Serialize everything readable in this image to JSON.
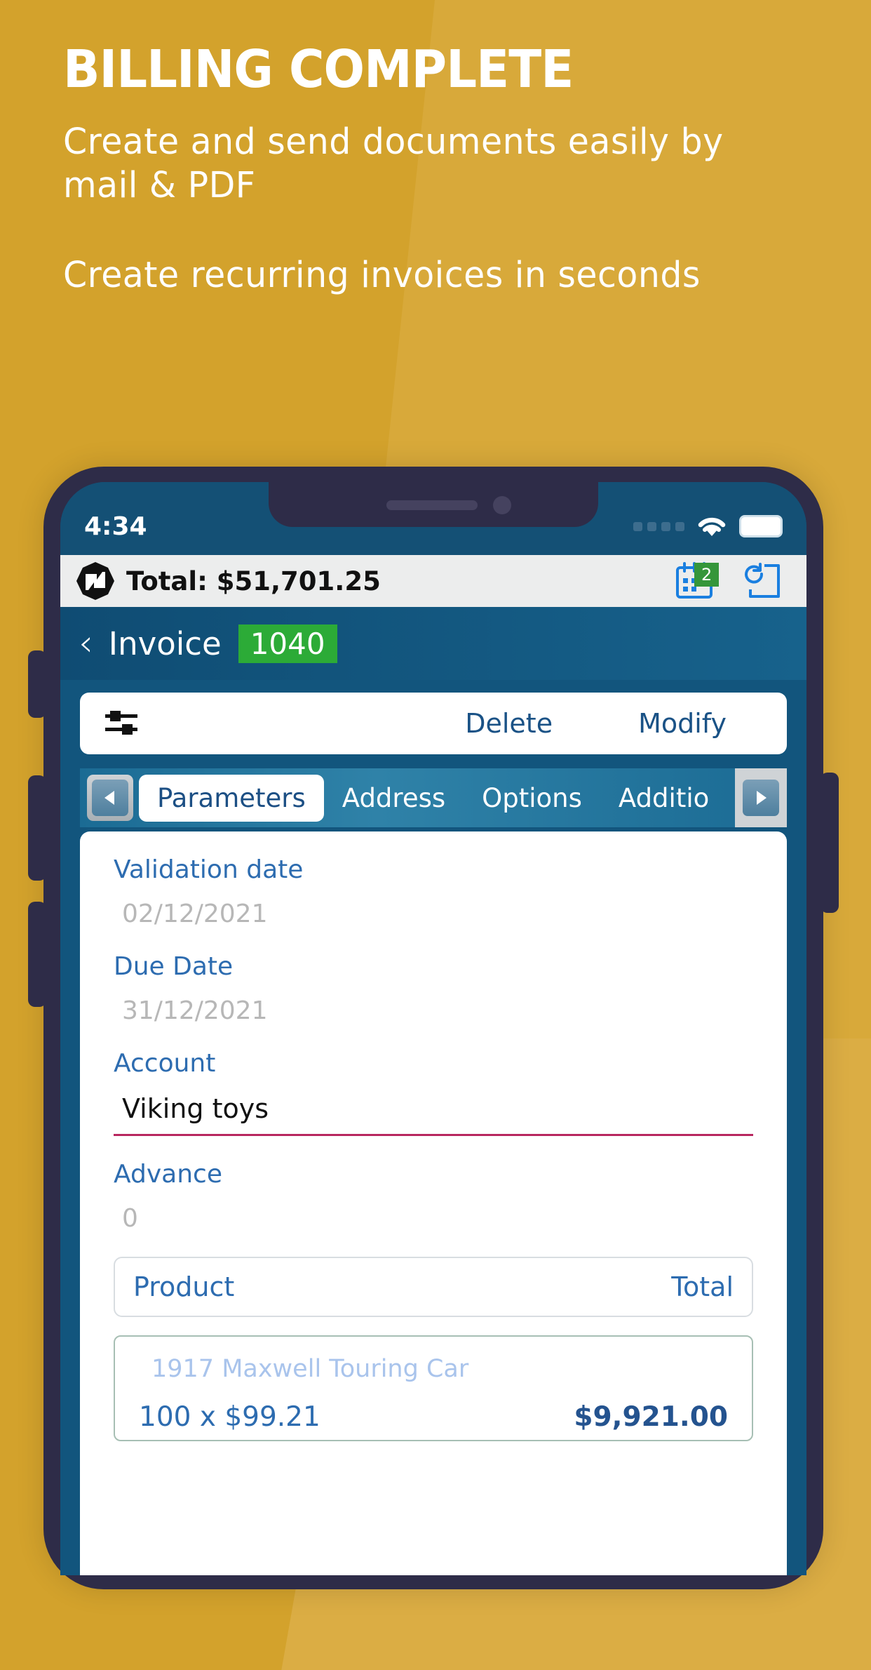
{
  "promo": {
    "headline": "BILLING COMPLETE",
    "sub1": "Create and send documents easily by mail & PDF",
    "sub2": "Create recurring invoices in seconds",
    "bg_color": "#d3a22c"
  },
  "phone": {
    "frame_color": "#2e2c48",
    "statusbar": {
      "time": "4:34",
      "wifi_icon": "wifi-icon",
      "battery_icon": "battery-icon",
      "signal_icon": "signal-dots-icon"
    }
  },
  "app": {
    "topbar": {
      "logo_icon": "app-logo-icon",
      "total_label": "Total: $51,701.25",
      "calendar_icon": "calendar-icon",
      "calendar_badge": "2",
      "refresh_icon": "refresh-document-icon",
      "badge_color": "#35963a"
    },
    "navbar": {
      "back_icon": "back-chevron-icon",
      "title": "Invoice",
      "badge": "1040",
      "badge_color": "#2cab37"
    },
    "actionbar": {
      "filter_icon": "filter-sliders-icon",
      "delete_label": "Delete",
      "modify_label": "Modify",
      "link_color": "#1a5286"
    },
    "tabs": {
      "prev_icon": "arrow-left-icon",
      "next_icon": "arrow-right-icon",
      "items": [
        {
          "label": "Parameters",
          "active": true
        },
        {
          "label": "Address",
          "active": false
        },
        {
          "label": "Options",
          "active": false
        },
        {
          "label": "Additio",
          "active": false
        }
      ]
    },
    "form": {
      "fields": [
        {
          "label": "Validation date",
          "value": "02/12/2021",
          "filled": false,
          "underline": false
        },
        {
          "label": "Due Date",
          "value": "31/12/2021",
          "filled": false,
          "underline": false
        },
        {
          "label": "Account",
          "value": "Viking toys",
          "filled": true,
          "underline": true
        },
        {
          "label": "Advance",
          "value": "0",
          "filled": false,
          "underline": false
        }
      ],
      "product_header": {
        "left": "Product",
        "right": "Total"
      },
      "product_row": {
        "name": "1917 Maxwell Touring Car",
        "qty_price": "100 x $99.21",
        "total": "$9,921.00"
      }
    }
  }
}
